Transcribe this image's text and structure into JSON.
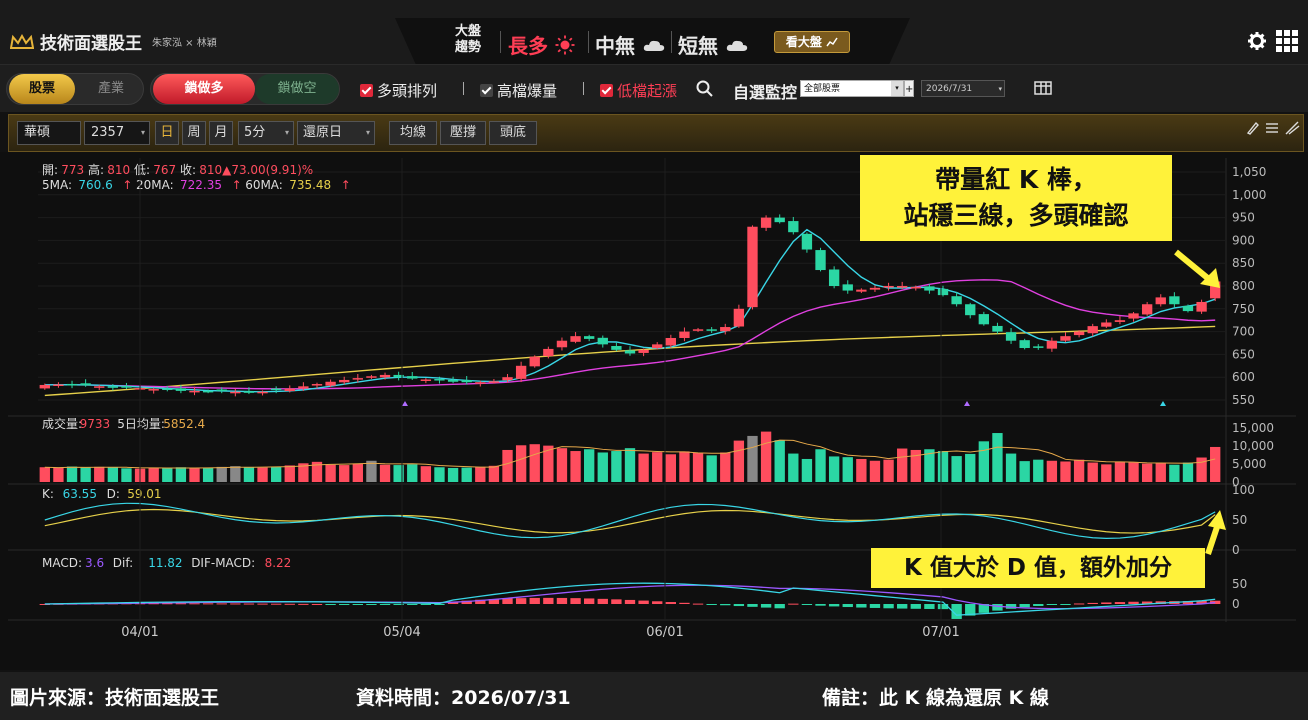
{
  "header": {
    "app_name": "技術面選股王",
    "partners": "朱家泓 × 林穎",
    "market_label_1": "大盤",
    "market_label_2": "趨勢",
    "long": "長多",
    "mid": "中無",
    "short": "短無",
    "market_button": "看大盤",
    "icons": [
      "crown-logo-icon",
      "sun-icon",
      "cloud-icon",
      "gear-icon",
      "grid-menu-icon"
    ]
  },
  "toolbar": {
    "seg1": [
      "股票",
      "產業"
    ],
    "seg2": [
      "鎖做多",
      "鎖做空"
    ],
    "filters": [
      {
        "label": "多頭排列",
        "checked": true
      },
      {
        "label": "高檔爆量",
        "checked": true
      },
      {
        "label": "低檔起漲",
        "checked": true
      }
    ],
    "watch_label": "自選監控",
    "watch_value": "全部股票",
    "date_value": "2026/7/31"
  },
  "chartbar": {
    "stock_name": "華碩",
    "stock_code": "2357",
    "periods": [
      "日",
      "周",
      "月"
    ],
    "interval": "5分",
    "adjust": "還原日",
    "buttons": [
      "均線",
      "壓撐",
      "頭底"
    ]
  },
  "price_info": {
    "open_label": "開:",
    "open": "773",
    "high_label": "高:",
    "high": "810",
    "low_label": "低:",
    "low": "767",
    "close_label": "收:",
    "close": "810",
    "change": "▲73.00(9.91)%",
    "ma5_label": "5MA:",
    "ma5": "760.6",
    "ma20_label": "20MA:",
    "ma20": "722.35",
    "ma60_label": "60MA:",
    "ma60": "735.48"
  },
  "volume_info": {
    "label": "成交量:",
    "value": "9733",
    "avg_label": "5日均量:",
    "avg": "5852.4"
  },
  "kd_info": {
    "k_label": "K:",
    "k": "63.55",
    "d_label": "D:",
    "d": "59.01"
  },
  "macd_info": {
    "macd_label": "MACD:",
    "macd": "3.6",
    "dif_label": "Dif:",
    "dif": "11.82",
    "osc_label": "DIF-MACD:",
    "osc": "8.22"
  },
  "price_axis": [
    "1,050",
    "1,000",
    "950",
    "900",
    "850",
    "800",
    "750",
    "700",
    "650",
    "600",
    "550"
  ],
  "volume_axis": [
    "15,000",
    "10,000",
    "5,000",
    "0"
  ],
  "kd_axis": [
    "100",
    "50",
    "0"
  ],
  "macd_axis": [
    "50",
    "0"
  ],
  "date_axis": [
    "04/01",
    "05/04",
    "06/01",
    "07/01"
  ],
  "annotations": {
    "callout_1_line_1": "帶量紅 K 棒，",
    "callout_1_line_2": "站穩三線，多頭確認",
    "callout_2": "K 值大於 D 值，額外加分"
  },
  "footer": {
    "source": "圖片來源：技術面選股王",
    "data_time": "資料時間：2026/07/31",
    "note": "備註：此 K 線為還原 K 線"
  },
  "colors": {
    "up": "#ff4d5e",
    "down": "#2bd6a4",
    "ma5": "#39d6e6",
    "ma20": "#e040e0",
    "ma60": "#e6d04a",
    "callout": "#fff23a"
  },
  "chart_data": {
    "type": "candlestick",
    "n_bars": 87,
    "price_ylim": [
      550,
      1050
    ],
    "closes": [
      583,
      584,
      583,
      582,
      580,
      578,
      577,
      576,
      574,
      572,
      570,
      570,
      568,
      570,
      568,
      566,
      568,
      572,
      575,
      580,
      585,
      590,
      594,
      598,
      602,
      605,
      600,
      597,
      595,
      593,
      590,
      589,
      589,
      591,
      600,
      625,
      645,
      662,
      680,
      690,
      684,
      672,
      660,
      652,
      660,
      672,
      686,
      700,
      705,
      702,
      710,
      750,
      930,
      950,
      940,
      918,
      880,
      835,
      800,
      790,
      792,
      796,
      800,
      800,
      798,
      790,
      780,
      760,
      736,
      716,
      700,
      680,
      664,
      665,
      680,
      690,
      700,
      712,
      720,
      725,
      740,
      760,
      775,
      760,
      745,
      765,
      810
    ],
    "volumes": [
      4100,
      3900,
      4300,
      4000,
      4200,
      4100,
      3800,
      3700,
      3900,
      4000,
      4100,
      3800,
      3900,
      4200,
      4400,
      4100,
      4000,
      4300,
      4600,
      5200,
      5600,
      4800,
      4700,
      5100,
      5900,
      4800,
      4700,
      4900,
      4400,
      4100,
      3900,
      4000,
      4200,
      4500,
      8900,
      10200,
      10500,
      10100,
      9400,
      8600,
      9100,
      8200,
      8600,
      9400,
      7900,
      8300,
      7700,
      8500,
      8100,
      7400,
      8200,
      11500,
      12800,
      14000,
      11600,
      7900,
      6400,
      9100,
      7100,
      6900,
      6400,
      5900,
      6200,
      9300,
      8900,
      9100,
      8600,
      7200,
      7800,
      11300,
      13600,
      7900,
      5800,
      6200,
      5900,
      5700,
      6200,
      5400,
      4900,
      5700,
      5400,
      5100,
      5300,
      4800,
      5400,
      6800,
      9733
    ],
    "k": [
      63.55
    ],
    "d": [
      59.01
    ],
    "macd": [
      3.6
    ],
    "dif": [
      11.82
    ]
  }
}
